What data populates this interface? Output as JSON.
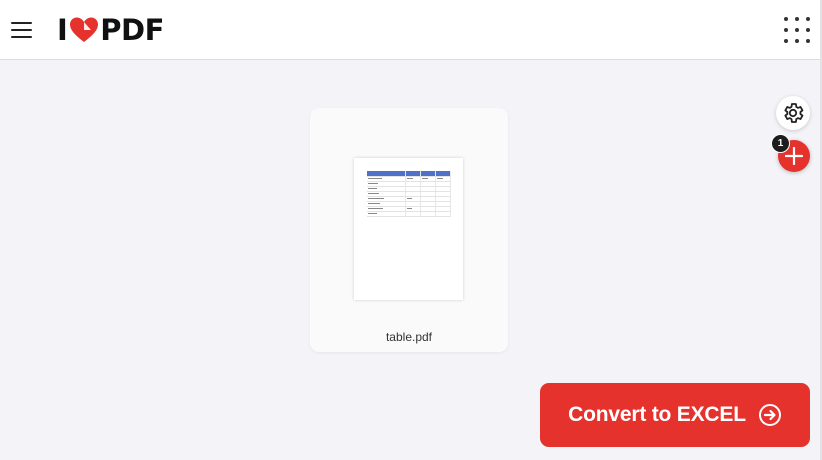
{
  "header": {
    "menu_icon": "hamburger-menu-icon",
    "logo": {
      "prefix": "I",
      "icon": "heart-icon",
      "suffix": "PDF",
      "brand_color": "#e5322d"
    },
    "apps_icon": "apps-grid-icon"
  },
  "workspace": {
    "files": [
      {
        "name": "table.pdf"
      }
    ]
  },
  "sidebar_tools": {
    "settings_icon": "gear-icon",
    "add_icon": "plus-icon",
    "file_count": "1"
  },
  "action": {
    "convert_label": "Convert to EXCEL",
    "convert_icon": "arrow-right-circle-icon",
    "accent_color": "#e5322d"
  }
}
